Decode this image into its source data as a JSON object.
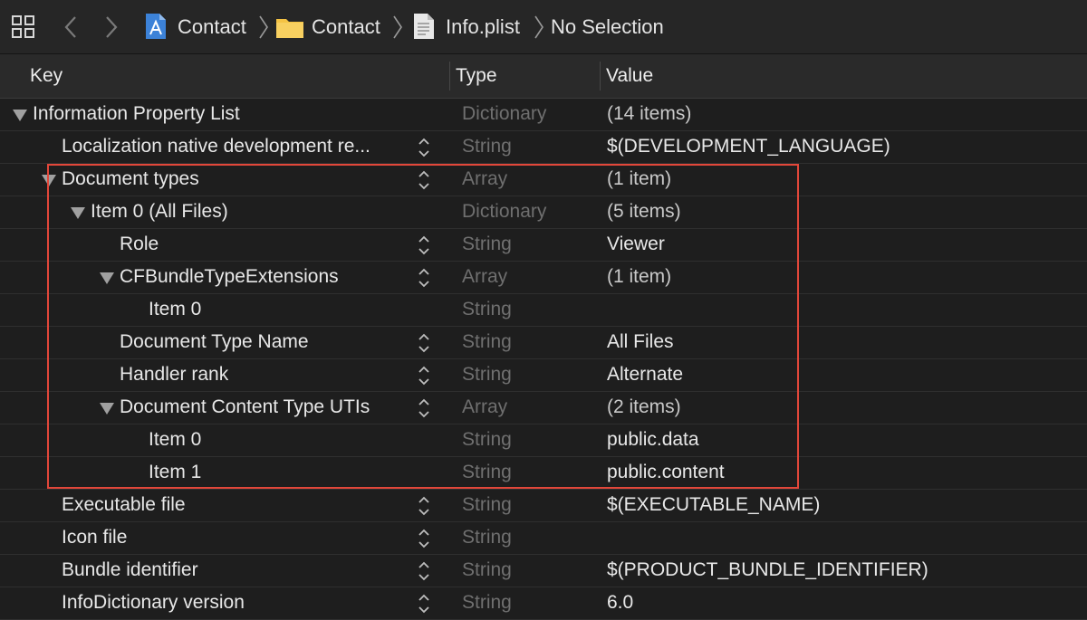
{
  "breadcrumb": {
    "items": [
      {
        "label": "Contact",
        "icon": "project-icon"
      },
      {
        "label": "Contact",
        "icon": "folder-icon"
      },
      {
        "label": "Info.plist",
        "icon": "plist-file-icon"
      },
      {
        "label": "No Selection",
        "icon": ""
      }
    ]
  },
  "columns": {
    "key": "Key",
    "type": "Type",
    "value": "Value"
  },
  "rows": [
    {
      "key": "Information Property List",
      "type": "Dictionary",
      "value": "(14 items)"
    },
    {
      "key": "Localization native development re...",
      "type": "String",
      "value": "$(DEVELOPMENT_LANGUAGE)"
    },
    {
      "key": "Document types",
      "type": "Array",
      "value": "(1 item)"
    },
    {
      "key": "Item 0 (All Files)",
      "type": "Dictionary",
      "value": "(5 items)"
    },
    {
      "key": "Role",
      "type": "String",
      "value": "Viewer"
    },
    {
      "key": "CFBundleTypeExtensions",
      "type": "Array",
      "value": "(1 item)"
    },
    {
      "key": "Item 0",
      "type": "String",
      "value": ""
    },
    {
      "key": "Document Type Name",
      "type": "String",
      "value": "All Files"
    },
    {
      "key": "Handler rank",
      "type": "String",
      "value": "Alternate"
    },
    {
      "key": "Document Content Type UTIs",
      "type": "Array",
      "value": "(2 items)"
    },
    {
      "key": "Item 0",
      "type": "String",
      "value": "public.data"
    },
    {
      "key": "Item 1",
      "type": "String",
      "value": "public.content"
    },
    {
      "key": "Executable file",
      "type": "String",
      "value": "$(EXECUTABLE_NAME)"
    },
    {
      "key": "Icon file",
      "type": "String",
      "value": ""
    },
    {
      "key": "Bundle identifier",
      "type": "String",
      "value": "$(PRODUCT_BUNDLE_IDENTIFIER)"
    },
    {
      "key": "InfoDictionary version",
      "type": "String",
      "value": "6.0"
    }
  ],
  "colors": {
    "highlight": "#e2473a",
    "background": "#1e1e1e",
    "type_text": "#6f6f6f"
  }
}
